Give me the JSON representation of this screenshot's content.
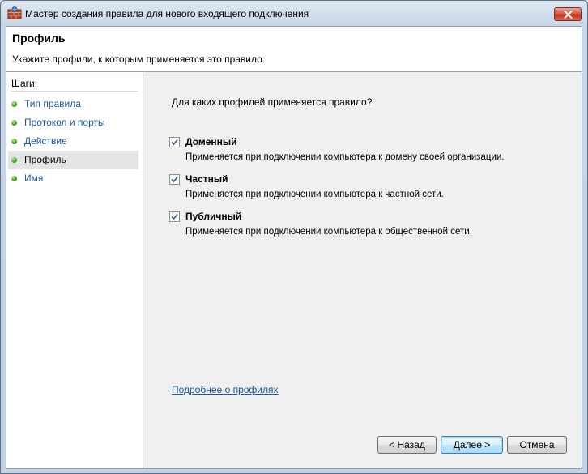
{
  "window": {
    "title": "Мастер создания правила для нового входящего подключения",
    "icon": "firewall-icon"
  },
  "header": {
    "title": "Профиль",
    "subtitle": "Укажите профили, к которым применяется это правило."
  },
  "steps": {
    "heading": "Шаги:",
    "items": [
      {
        "label": "Тип правила",
        "current": false
      },
      {
        "label": "Протокол и порты",
        "current": false
      },
      {
        "label": "Действие",
        "current": false
      },
      {
        "label": "Профиль",
        "current": true
      },
      {
        "label": "Имя",
        "current": false
      }
    ]
  },
  "main": {
    "question": "Для каких профилей применяется правило?",
    "options": [
      {
        "label": "Доменный",
        "checked": true,
        "description": "Применяется при подключении компьютера к домену своей организации."
      },
      {
        "label": "Частный",
        "checked": true,
        "description": "Применяется при подключении компьютера к частной сети."
      },
      {
        "label": "Публичный",
        "checked": true,
        "description": "Применяется при подключении компьютера к общественной сети."
      }
    ],
    "learn_more_link": "Подробнее о профилях"
  },
  "buttons": {
    "back": "< Назад",
    "next": "Далее >",
    "cancel": "Отмена"
  },
  "colors": {
    "link": "#1e5aa0",
    "step_dot": "#3ea424",
    "close_button": "#c2351c"
  }
}
